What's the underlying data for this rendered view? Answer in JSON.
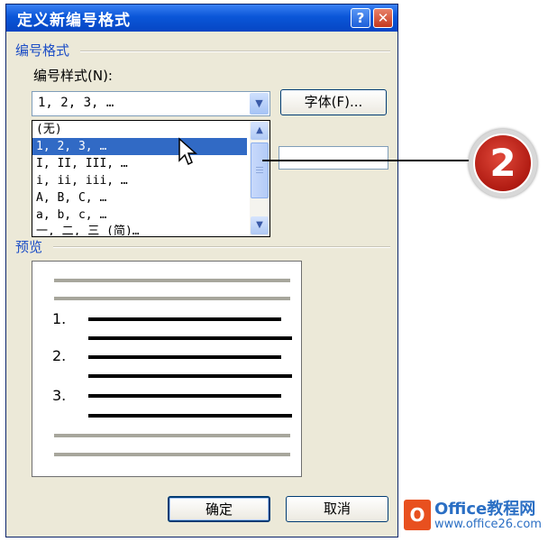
{
  "dialog": {
    "title": "定义新编号格式",
    "help_button": "?",
    "close_button": "✕",
    "number_format_group": "编号格式",
    "number_style_label": "编号样式(N):",
    "number_style_value": "1, 2, 3, …",
    "font_button": "字体(F)...",
    "dropdown_options": [
      "(无)",
      "1, 2, 3, …",
      "I, II, III, …",
      "i, ii, iii, …",
      "A, B, C, …",
      "a, b, c, …",
      "一, 二, 三 (简)…"
    ],
    "selected_option_index": 1,
    "preview_group": "预览",
    "preview_numbers": [
      "1.",
      "2.",
      "3."
    ],
    "ok_button": "确定",
    "cancel_button": "取消"
  },
  "callout": {
    "number": "2"
  },
  "watermark": {
    "title": "Office教程网",
    "url": "www.office26.com"
  },
  "icons": {
    "combo_arrow": "chevron-down-icon",
    "scroll_up": "chevron-up-icon",
    "scroll_down": "chevron-down-icon",
    "cursor": "mouse-cursor-icon"
  },
  "colors": {
    "titlebar": "#0a56d8",
    "dialog_bg": "#ece9d8",
    "selection": "#316ac5",
    "badge": "#c0251a",
    "group_label": "#1d4ec6"
  }
}
